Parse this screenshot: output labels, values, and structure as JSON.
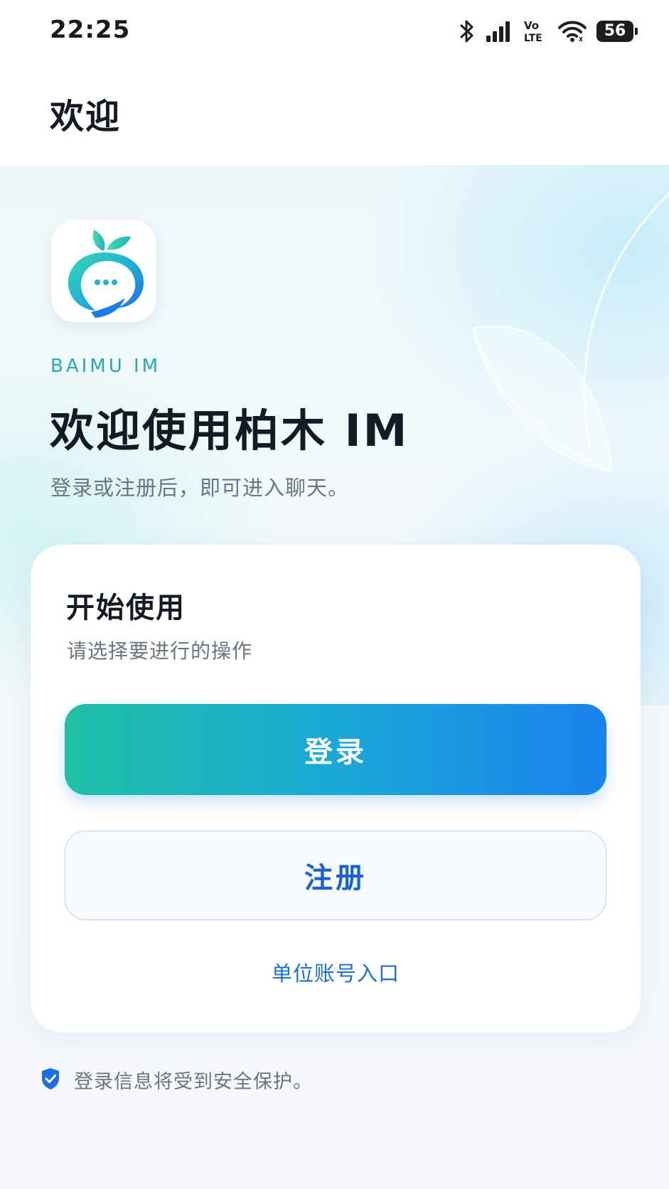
{
  "status_bar": {
    "time": "22:25",
    "network_label": "Vo LTE",
    "battery": "56"
  },
  "header": {
    "title": "欢迎"
  },
  "hero": {
    "brand": "BAIMU IM",
    "heading": "欢迎使用柏木 IM",
    "subtitle": "登录或注册后，即可进入聊天。"
  },
  "card": {
    "title": "开始使用",
    "subtitle": "请选择要进行的操作",
    "login_label": "登录",
    "register_label": "注册",
    "org_link_label": "单位账号入口"
  },
  "footer": {
    "security_text": "登录信息将受到安全保护。"
  },
  "colors": {
    "accent_start": "#1fc0a6",
    "accent_end": "#1a82ee",
    "link": "#1a6fd6",
    "brand_text": "#25a9b7"
  },
  "icons": {
    "bluetooth": "bluetooth-icon",
    "signal": "signal-icon",
    "wifi": "wifi-icon",
    "battery": "battery-icon",
    "logo": "app-logo-icon",
    "security": "shield-check-icon"
  }
}
